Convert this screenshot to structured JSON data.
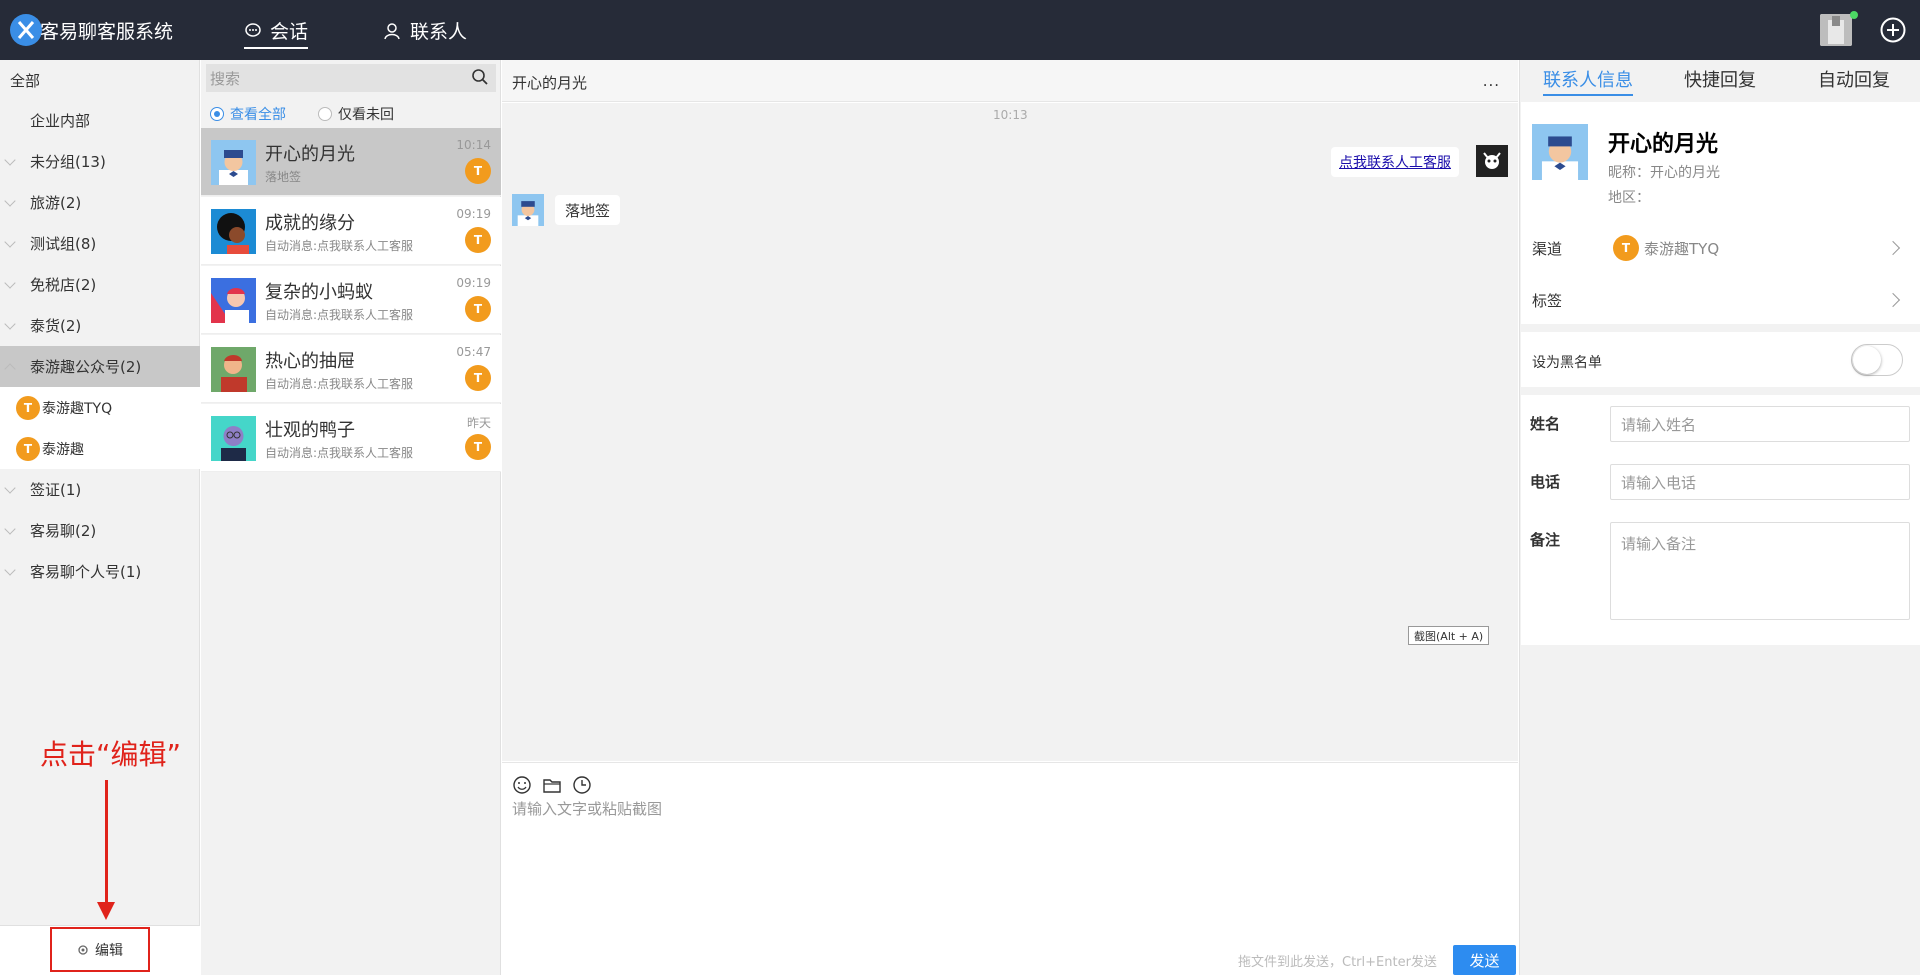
{
  "app": {
    "title": "客易聊客服系统"
  },
  "nav": {
    "tabs": [
      {
        "label": "会话",
        "active": true
      },
      {
        "label": "联系人",
        "active": false
      }
    ]
  },
  "sidebar": {
    "all": "全部",
    "internal": "企业内部",
    "groups": [
      {
        "label": "未分组(13)"
      },
      {
        "label": "旅游(2)"
      },
      {
        "label": "测试组(8)"
      },
      {
        "label": "免税店(2)"
      },
      {
        "label": "泰货(2)"
      },
      {
        "label": "泰游趣公众号(2)",
        "selected": true
      },
      {
        "label": "签证(1)"
      },
      {
        "label": "客易聊(2)"
      },
      {
        "label": "客易聊个人号(1)"
      }
    ],
    "channels": [
      {
        "label": "泰游趣TYQ"
      },
      {
        "label": "泰游趣"
      }
    ],
    "edit_label": "编辑"
  },
  "annotation": {
    "text": "点击“编辑”"
  },
  "conversations": {
    "search_placeholder": "搜索",
    "filter_all": "查看全部",
    "filter_unread": "仅看未回",
    "items": [
      {
        "name": "开心的月光",
        "msg": "落地签",
        "time": "10:14",
        "selected": true
      },
      {
        "name": "成就的缘分",
        "msg": "自动消息:点我联系人工客服",
        "time": "09:19"
      },
      {
        "name": "复杂的小蚂蚁",
        "msg": "自动消息:点我联系人工客服",
        "time": "09:19"
      },
      {
        "name": "热心的抽屉",
        "msg": "自动消息:点我联系人工客服",
        "time": "05:47"
      },
      {
        "name": "壮观的鸭子",
        "msg": "自动消息:点我联系人工客服",
        "time": "昨天"
      }
    ]
  },
  "chat": {
    "title": "开心的月光",
    "more": "...",
    "timestamp": "10:13",
    "outgoing": "点我联系人工客服",
    "incoming": "落地签",
    "screenshot_tip": "截图(Alt + A)",
    "input_placeholder": "请输入文字或粘贴截图",
    "hint": "拖文件到此发送，Ctrl+Enter发送",
    "send": "发送"
  },
  "contact": {
    "tabs": [
      "联系人信息",
      "快捷回复",
      "自动回复"
    ],
    "name": "开心的月光",
    "nickname": "昵称：开心的月光",
    "region": "地区：",
    "channel_label": "渠道",
    "channel_value": "泰游趣TYQ",
    "tag_label": "标签",
    "blacklist_label": "设为黑名单",
    "blacklist_on": false,
    "fields": [
      {
        "label": "姓名",
        "placeholder": "请输入姓名"
      },
      {
        "label": "电话",
        "placeholder": "请输入电话"
      },
      {
        "label": "备注",
        "placeholder": "请输入备注"
      }
    ]
  },
  "colors": {
    "accent": "#3a8ee6",
    "topbar": "#262b38",
    "channel": "#f29b1d",
    "annotation": "#e0231b",
    "send": "#2d8cf0"
  }
}
